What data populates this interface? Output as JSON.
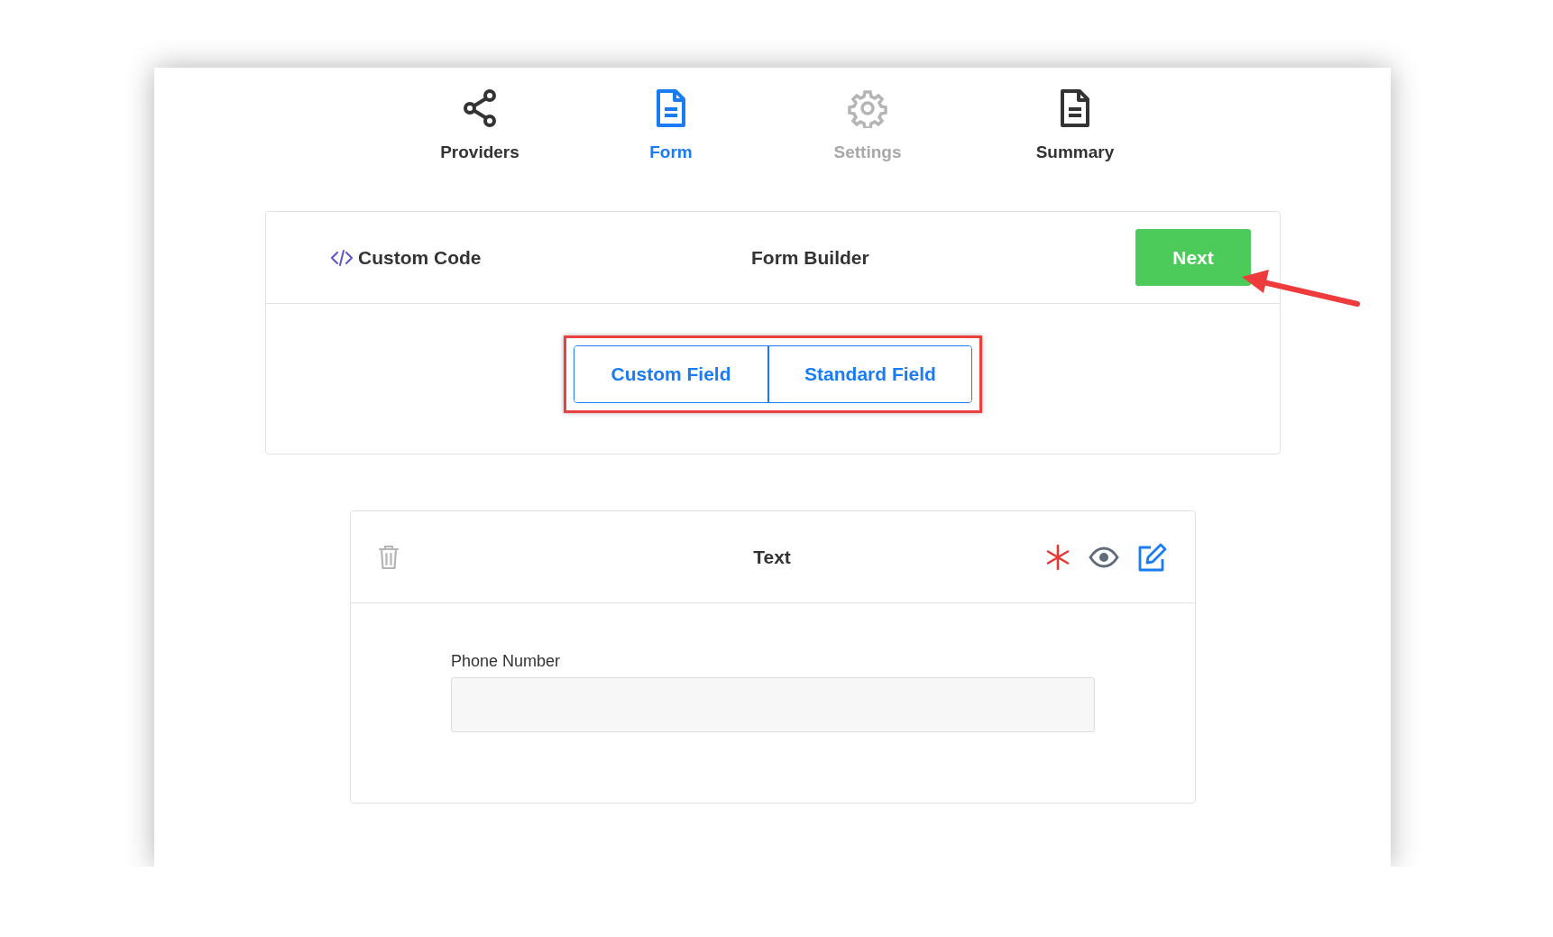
{
  "steps": [
    {
      "label": "Providers",
      "kind": "share",
      "selected": false,
      "disabled": false
    },
    {
      "label": "Form",
      "kind": "document",
      "selected": true,
      "disabled": false
    },
    {
      "label": "Settings",
      "kind": "gear",
      "selected": false,
      "disabled": true
    },
    {
      "label": "Summary",
      "kind": "document",
      "selected": false,
      "disabled": false
    }
  ],
  "builder": {
    "custom_code": "Custom Code",
    "title": "Form Builder",
    "next_button": "Next",
    "field_types": [
      {
        "label": "Custom Field"
      },
      {
        "label": "Standard Field"
      }
    ]
  },
  "field_card": {
    "type_title": "Text",
    "required": true,
    "field": {
      "label": "Phone Number"
    }
  }
}
